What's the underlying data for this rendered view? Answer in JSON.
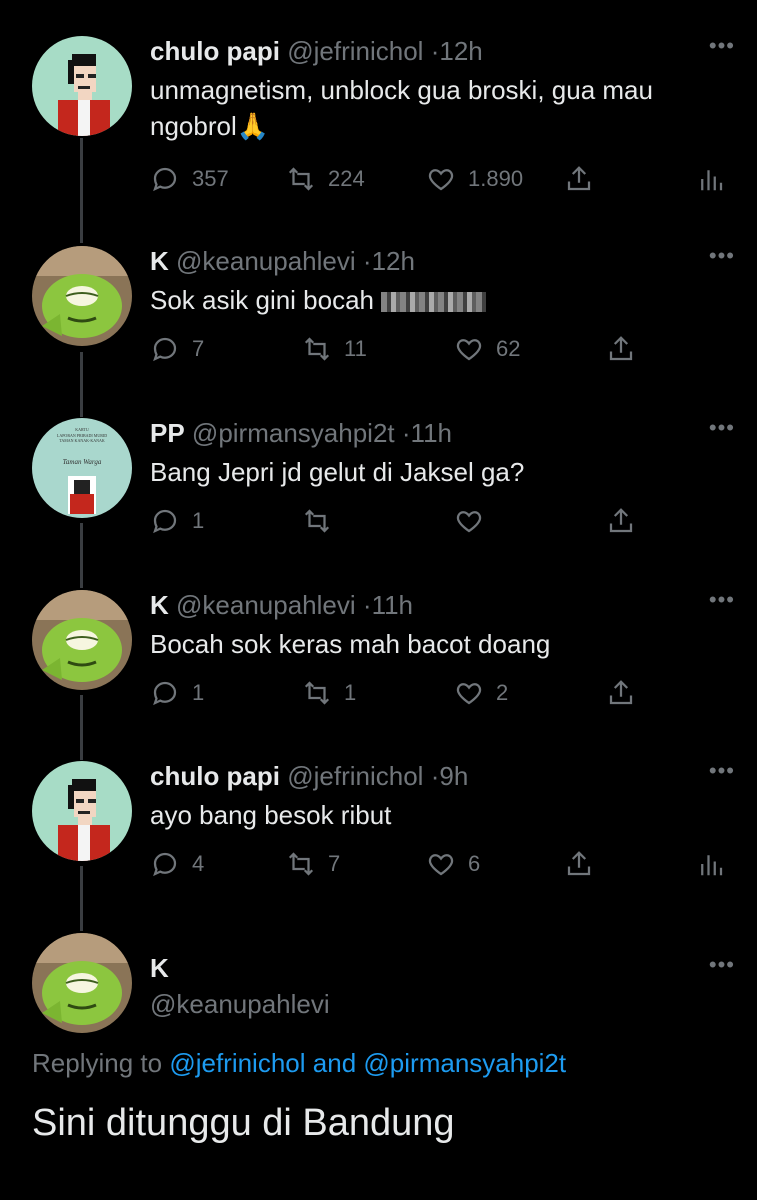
{
  "tweets": [
    {
      "name": "chulo papi",
      "handle": "@jefrinichol",
      "sep": "·",
      "time": "12h",
      "text": "unmagnetism, unblock gua broski, gua mau ngobrol",
      "emoji": "🙏",
      "replies": "357",
      "retweets": "224",
      "likes": "1.890",
      "avatar": "pixel-person-avatar"
    },
    {
      "name": "K",
      "handle": "@keanupahlevi",
      "sep": "·",
      "time": "12h",
      "text": "Sok asik gini bocah",
      "replies": "7",
      "retweets": "11",
      "likes": "62",
      "avatar": "green-monster-avatar"
    },
    {
      "name": "PP",
      "handle": "@pirmansyahpi2t",
      "sep": "·",
      "time": "11h",
      "text": "Bang Jepri jd gelut di Jaksel ga?",
      "replies": "1",
      "retweets": "",
      "likes": "",
      "avatar": "member-card-avatar",
      "card_line1": "KARTU",
      "card_line2": "LAPORAN PRIBADI MURID",
      "card_line3": "TAMAN KANAK-KANAK",
      "card_sign": "Taman Warga"
    },
    {
      "name": "K",
      "handle": "@keanupahlevi",
      "sep": "·",
      "time": "11h",
      "text": "Bocah sok keras mah bacot doang",
      "replies": "1",
      "retweets": "1",
      "likes": "2",
      "avatar": "green-monster-avatar"
    },
    {
      "name": "chulo papi",
      "handle": "@jefrinichol",
      "sep": "·",
      "time": "9h",
      "text": "ayo bang besok ribut",
      "replies": "4",
      "retweets": "7",
      "likes": "6",
      "avatar": "pixel-person-avatar"
    }
  ],
  "main_tweet": {
    "name": "K",
    "handle": "@keanupahlevi",
    "replying_label": "Replying to",
    "mention1": "@jefrinichol",
    "and_label": "and",
    "mention2": "@pirmansyahpi2t",
    "text": "Sini ditunggu di Bandung",
    "avatar": "green-monster-avatar"
  },
  "more_icon": "•••",
  "colors": {
    "background": "#000000",
    "text": "#e7e9ea",
    "muted": "#71767b",
    "accent": "#1d9bf0",
    "thread_line": "#3a3d41"
  }
}
